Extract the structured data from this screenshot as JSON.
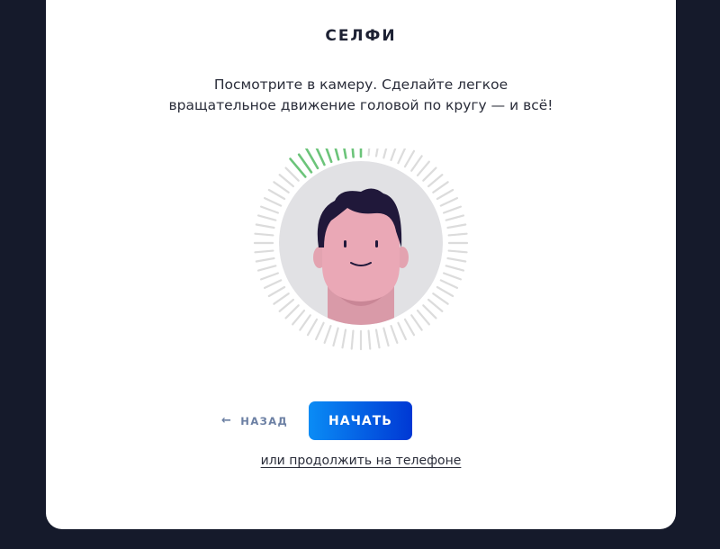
{
  "page": {
    "title": "СЕЛФИ",
    "instruction_line1": "Посмотрите в камеру. Сделайте легкое",
    "instruction_line2": "вращательное движение головой по кругу — и всё!"
  },
  "progress_ring": {
    "completed_fraction": 0.13,
    "active_color": "#6cc47a",
    "inactive_color": "#dcdcdc"
  },
  "actions": {
    "back_label": "НАЗАД",
    "back_icon": "arrow-left-icon",
    "start_label": "НАЧАТЬ",
    "phone_link_label": "или продолжить на телефоне"
  },
  "colors": {
    "background": "#151a2b",
    "card": "#ffffff",
    "primary_start": "#0a8cf5",
    "primary_end": "#0038d4",
    "back_text": "#6b7fa3"
  }
}
